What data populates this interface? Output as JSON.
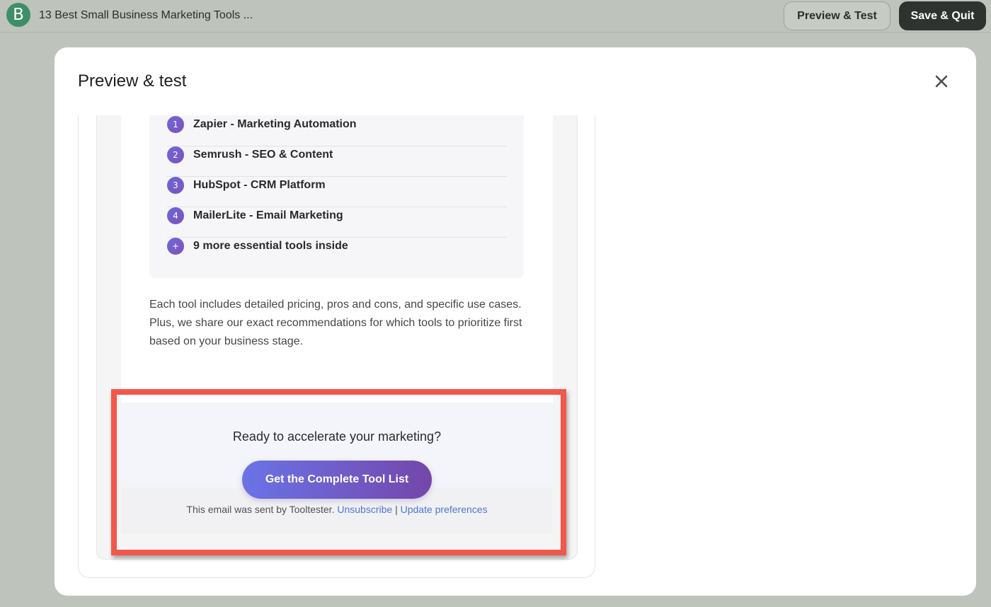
{
  "app": {
    "logo_letter": "B",
    "document_title": "13 Best Small Business Marketing Tools ...",
    "preview_button_label": "Preview & Test",
    "save_button_label": "Save & Quit"
  },
  "modal": {
    "title": "Preview & test",
    "close_icon": "close-icon"
  },
  "email": {
    "tools": [
      {
        "badge": "1",
        "label": "Zapier - Marketing Automation"
      },
      {
        "badge": "2",
        "label": "Semrush - SEO & Content"
      },
      {
        "badge": "3",
        "label": "HubSpot - CRM Platform"
      },
      {
        "badge": "4",
        "label": "MailerLite - Email Marketing"
      },
      {
        "badge": "+",
        "label": "9 more essential tools inside"
      }
    ],
    "description": "Each tool includes detailed pricing, pros and cons, and specific use cases. Plus, we share our exact recommendations for which tools to prioritize first based on your business stage.",
    "cta_heading": "Ready to accelerate your marketing?",
    "cta_button_label": "Get the Complete Tool List",
    "footer": {
      "sent_by_text": "This email was sent by Tooltester.",
      "unsubscribe_label": "Unsubscribe",
      "separator": "|",
      "preferences_label": "Update preferences"
    }
  },
  "colors": {
    "highlight_border": "#f2574c",
    "accent_gradient_start": "#6a73e6",
    "accent_gradient_end": "#7446a8",
    "link": "#4f74d4"
  }
}
